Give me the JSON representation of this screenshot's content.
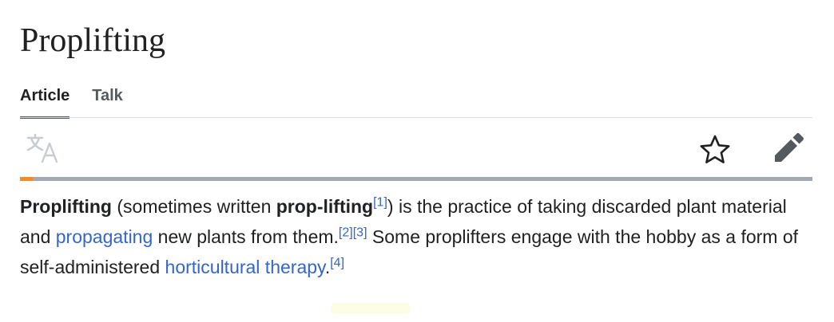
{
  "page": {
    "title": "Proplifting"
  },
  "tabs": [
    {
      "label": "Article",
      "active": true
    },
    {
      "label": "Talk",
      "active": false
    }
  ],
  "toolbar": {
    "icons": [
      "translate-icon",
      "star-icon",
      "pencil-icon"
    ]
  },
  "reading_progress": 0.016,
  "lead": {
    "bold_term": "Proplifting",
    "seg1": " (sometimes written ",
    "bold_alt": "prop-lifting",
    "ref1": "[1]",
    "seg2": ") is the practice of taking discarded plant material and ",
    "link1": "propagating",
    "seg3": " new plants from them.",
    "ref2": "[2]",
    "ref3": "[3]",
    "seg4": " Some proplifters engage with the hobby as a form of self-administered ",
    "link2": "horticultural therapy",
    "seg5": ".",
    "ref4": "[4]"
  },
  "colors": {
    "link": "#3366cc",
    "text": "#202122",
    "progress_fill": "#f28c28",
    "progress_track": "#a2a9b1"
  }
}
